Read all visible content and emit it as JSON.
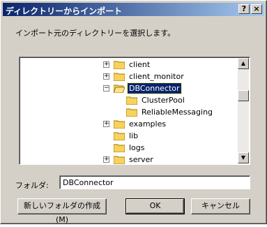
{
  "window": {
    "title": "ディレクトリーからインポート",
    "help_label": "?",
    "close_label": "×"
  },
  "instruction": "インポート元のディレクトリーを選択します。",
  "tree": {
    "items": [
      {
        "label": "client",
        "expander": "+",
        "selected": false
      },
      {
        "label": "client_monitor",
        "expander": "+",
        "selected": false
      },
      {
        "label": "DBConnector",
        "expander": "−",
        "selected": true
      },
      {
        "label": "ClusterPool",
        "expander": "",
        "selected": false
      },
      {
        "label": "ReliableMessaging",
        "expander": "",
        "selected": false
      },
      {
        "label": "examples",
        "expander": "+",
        "selected": false
      },
      {
        "label": "lib",
        "expander": "",
        "selected": false
      },
      {
        "label": "logs",
        "expander": "",
        "selected": false
      },
      {
        "label": "server",
        "expander": "+",
        "selected": false
      }
    ]
  },
  "folder": {
    "label": "フォルダ:",
    "value": "DBConnector"
  },
  "buttons": {
    "new_folder": "新しいフォルダの作成(M)",
    "ok": "OK",
    "cancel": "キャンセル"
  },
  "colors": {
    "titlebar": "#0a246a",
    "selection": "#0a246a",
    "folder": "#f7d35e"
  }
}
